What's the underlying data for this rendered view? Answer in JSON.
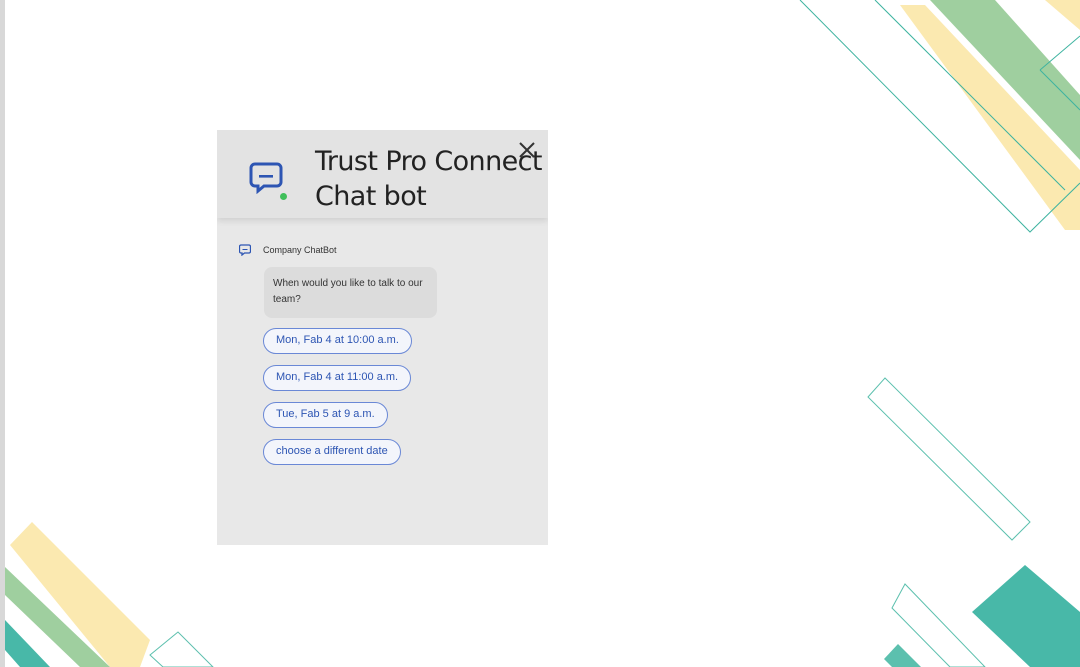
{
  "widget": {
    "title": "Trust Pro Connect Chat bot",
    "close_icon": "close-icon",
    "status": "online",
    "status_color": "#3fbf5a",
    "accent_color": "#2d55b3"
  },
  "conversation": {
    "sender_name": "Company ChatBot",
    "message": "When would you like to talk to our team?",
    "options": [
      "Mon, Fab 4 at 10:00 a.m.",
      "Mon, Fab 4 at 11:00 a.m.",
      "Tue, Fab 5 at 9 a.m.",
      "choose a different date"
    ]
  }
}
